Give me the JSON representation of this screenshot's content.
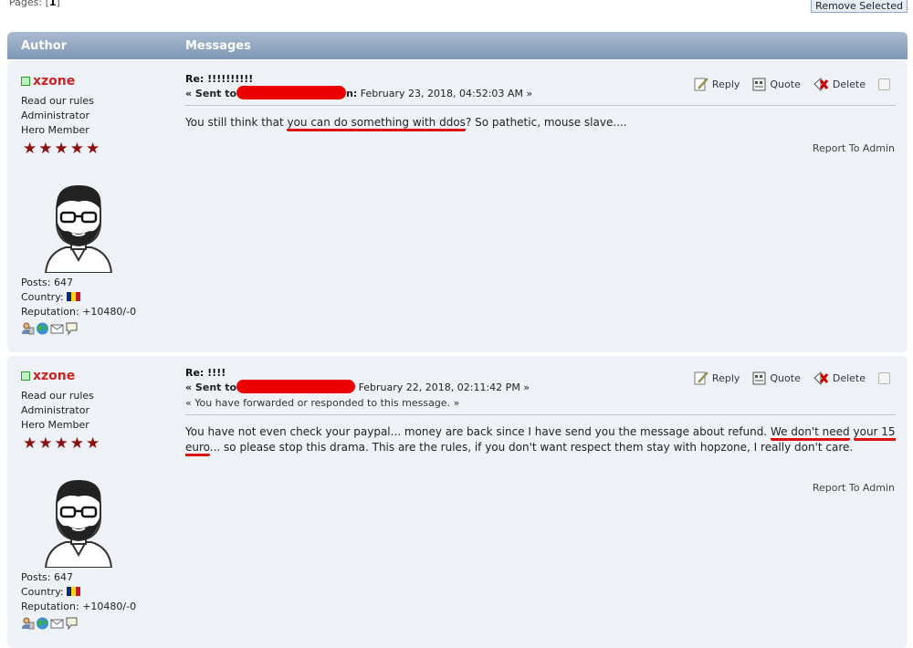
{
  "top": {
    "pages_label": "Pages: [",
    "pages_current": "1",
    "pages_end": "]",
    "remove_selected": "Remove Selected"
  },
  "header": {
    "author": "Author",
    "messages": "Messages"
  },
  "actions": {
    "reply": "Reply",
    "quote": "Quote",
    "delete": "Delete",
    "report": "Report To Admin"
  },
  "posts": [
    {
      "author": {
        "name": "xzone",
        "rules": "Read our rules",
        "role": "Administrator",
        "rank": "Hero Member",
        "stars": "★★★★★",
        "posts": "Posts: 647",
        "country": "Country:",
        "reputation": "Reputation: +10480/-0"
      },
      "subject": "Re: !!!!!!!!!!",
      "sent_prefix": "« Sent to",
      "sent_mid": "n:",
      "sent_date": "February 23, 2018, 04:52:03 AM »",
      "body_a": "You still think that ",
      "body_u": "you can do something with ddos",
      "body_b": "? So pathetic, mouse slave...."
    },
    {
      "author": {
        "name": "xzone",
        "rules": "Read our rules",
        "role": "Administrator",
        "rank": "Hero Member",
        "stars": "★★★★★",
        "posts": "Posts: 647",
        "country": "Country:",
        "reputation": "Reputation: +10480/-0"
      },
      "subject": "Re: !!!!",
      "sent_prefix": "« Sent to",
      "sent_date": "February 22, 2018, 02:11:42 PM »",
      "forwarded": "« You have forwarded or responded to this message. »",
      "body_a": "You have not even check your paypal... money are back since I have send you the message about refund. ",
      "body_u1": "We don't need",
      "body_u2": "your 15 euro",
      "body_b": "... so please stop this drama. This are the rules, if you don't want respect them stay with hopzone, I really don't care."
    }
  ]
}
